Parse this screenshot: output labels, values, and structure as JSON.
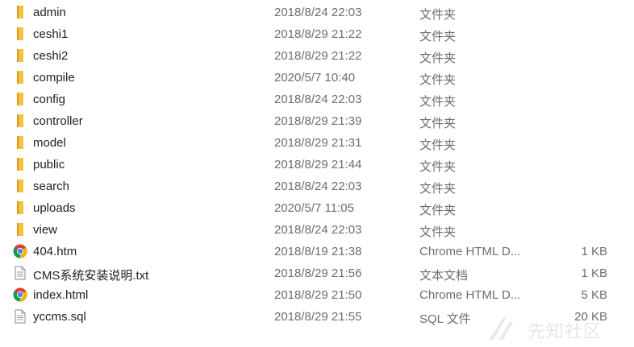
{
  "files": [
    {
      "name": "admin",
      "date": "2018/8/24 22:03",
      "type": "文件夹",
      "size": "",
      "icon": "folder-icon"
    },
    {
      "name": "ceshi1",
      "date": "2018/8/29 21:22",
      "type": "文件夹",
      "size": "",
      "icon": "folder-icon"
    },
    {
      "name": "ceshi2",
      "date": "2018/8/29 21:22",
      "type": "文件夹",
      "size": "",
      "icon": "folder-icon"
    },
    {
      "name": "compile",
      "date": "2020/5/7 10:40",
      "type": "文件夹",
      "size": "",
      "icon": "folder-icon"
    },
    {
      "name": "config",
      "date": "2018/8/24 22:03",
      "type": "文件夹",
      "size": "",
      "icon": "folder-icon"
    },
    {
      "name": "controller",
      "date": "2018/8/29 21:39",
      "type": "文件夹",
      "size": "",
      "icon": "folder-icon"
    },
    {
      "name": "model",
      "date": "2018/8/29 21:31",
      "type": "文件夹",
      "size": "",
      "icon": "folder-icon"
    },
    {
      "name": "public",
      "date": "2018/8/29 21:44",
      "type": "文件夹",
      "size": "",
      "icon": "folder-icon"
    },
    {
      "name": "search",
      "date": "2018/8/24 22:03",
      "type": "文件夹",
      "size": "",
      "icon": "folder-icon"
    },
    {
      "name": "uploads",
      "date": "2020/5/7 11:05",
      "type": "文件夹",
      "size": "",
      "icon": "folder-icon"
    },
    {
      "name": "view",
      "date": "2018/8/24 22:03",
      "type": "文件夹",
      "size": "",
      "icon": "folder-icon"
    },
    {
      "name": "404.htm",
      "date": "2018/8/19 21:38",
      "type": "Chrome HTML D...",
      "size": "1 KB",
      "icon": "chrome-icon"
    },
    {
      "name": "CMS系统安装说明.txt",
      "date": "2018/8/29 21:56",
      "type": "文本文档",
      "size": "1 KB",
      "icon": "text-file-icon"
    },
    {
      "name": "index.html",
      "date": "2018/8/29 21:50",
      "type": "Chrome HTML D...",
      "size": "5 KB",
      "icon": "chrome-icon"
    },
    {
      "name": "yccms.sql",
      "date": "2018/8/29 21:55",
      "type": "SQL 文件",
      "size": "20 KB",
      "icon": "text-file-icon"
    }
  ],
  "watermark": {
    "text": "先知社区",
    "icon": "xianzhi-logo-icon"
  },
  "colors": {
    "folder": "#f5c242",
    "folder_dark": "#e0a82e",
    "text_primary": "#1f1f1f",
    "text_secondary": "#6d6d6d"
  }
}
